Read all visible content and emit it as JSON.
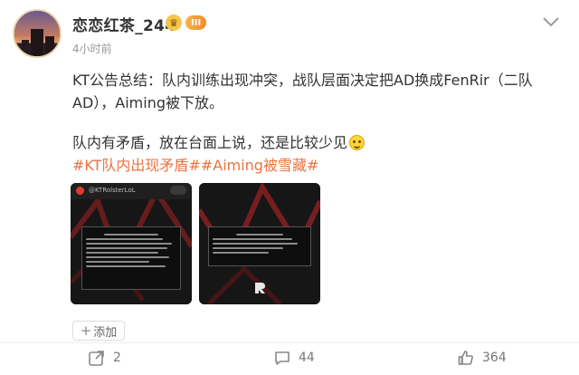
{
  "post": {
    "author": {
      "name": "恋恋红茶_244",
      "level_badge": "III"
    },
    "timestamp": "4小时前",
    "paragraphs": [
      "KT公告总结：队内训练出现冲突，战队层面决定把AD换成FenRir（二队AD），Aiming被下放。",
      "队内有矛盾，放在台面上说，还是比较少见"
    ],
    "hashtags": "#KT队内出现矛盾##Aiming被雪藏#",
    "images": [
      {
        "handle": "@KTRolsterLoL"
      },
      {
        "handle": ""
      }
    ],
    "add_button": {
      "plus": "+",
      "label": "添加"
    },
    "actions": {
      "repost_count": "2",
      "comment_count": "44",
      "like_count": "364"
    },
    "colors": {
      "hashtag": "#eb7340",
      "text": "#333333",
      "meta": "#999999",
      "badge": "#f08a2c"
    },
    "icons": [
      "vip-icon",
      "more-icon",
      "emoji-icon",
      "repost-icon",
      "comment-icon",
      "like-icon"
    ]
  }
}
